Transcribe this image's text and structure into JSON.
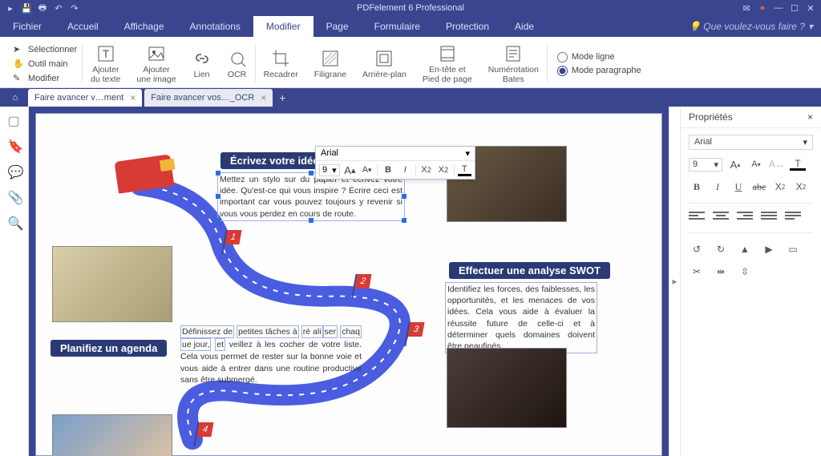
{
  "app": {
    "title": "PDFelement 6 Professional",
    "help_placeholder": "Que voulez-vous faire ?"
  },
  "menus": {
    "items": [
      "Fichier",
      "Accueil",
      "Affichage",
      "Annotations",
      "Modifier",
      "Page",
      "Formulaire",
      "Protection",
      "Aide"
    ],
    "active_index": 4
  },
  "ribbon": {
    "mini": [
      "Sélectionner",
      "Outil main",
      "Modifier"
    ],
    "big": [
      {
        "label": "Ajouter\ndu texte"
      },
      {
        "label": "Ajouter\nune image"
      },
      {
        "label": "Lien"
      },
      {
        "label": "OCR"
      },
      {
        "label": "Recadrer"
      },
      {
        "label": "Filigrane"
      },
      {
        "label": "Arrière-plan"
      },
      {
        "label": "En-tête et\nPied de page"
      },
      {
        "label": "Numérotation\nBates"
      }
    ],
    "mode": {
      "line": "Mode ligne",
      "para": "Mode paragraphe",
      "selected": "para"
    }
  },
  "tabs": {
    "items": [
      {
        "label": "Faire avancer v…ment",
        "active": true
      },
      {
        "label": "Faire avancer vos…_OCR",
        "active": false
      }
    ]
  },
  "floating_toolbar": {
    "font": "Arial",
    "size": "9"
  },
  "document": {
    "heading1": "Écrivez votre idée",
    "text1": "Mettez un stylo sur du papier et écrivez votre idée. Qu'est-ce qui vous inspire ? Écrire ceci est important car vous pouvez toujours y revenir si vous vous perdez en cours de route.",
    "heading2": "Effectuer une analyse SWOT",
    "text2": "Identifiez les forces, des faiblesses, les opportunités, et les menaces de vos idées. Cela vous aide à évaluer la réussite future de celle-ci et à déterminer quels domaines doivent être peaufinés.",
    "heading3": "Planifiez un agenda",
    "text3_a": "Définissez de",
    "text3_b": "petites tâches à",
    "text3_c": "ré ali",
    "text3_d": "ser",
    "text3_e": "chaq",
    "text3_f": "ue jour,",
    "text3_g": "et",
    "text3_rest": "veillez à les cocher de votre liste. Cela vous permet de rester sur la bonne voie et vous aide à entrer dans une routine productive sans être submergé."
  },
  "properties": {
    "title": "Propriétés",
    "font": "Arial",
    "size": "9"
  }
}
